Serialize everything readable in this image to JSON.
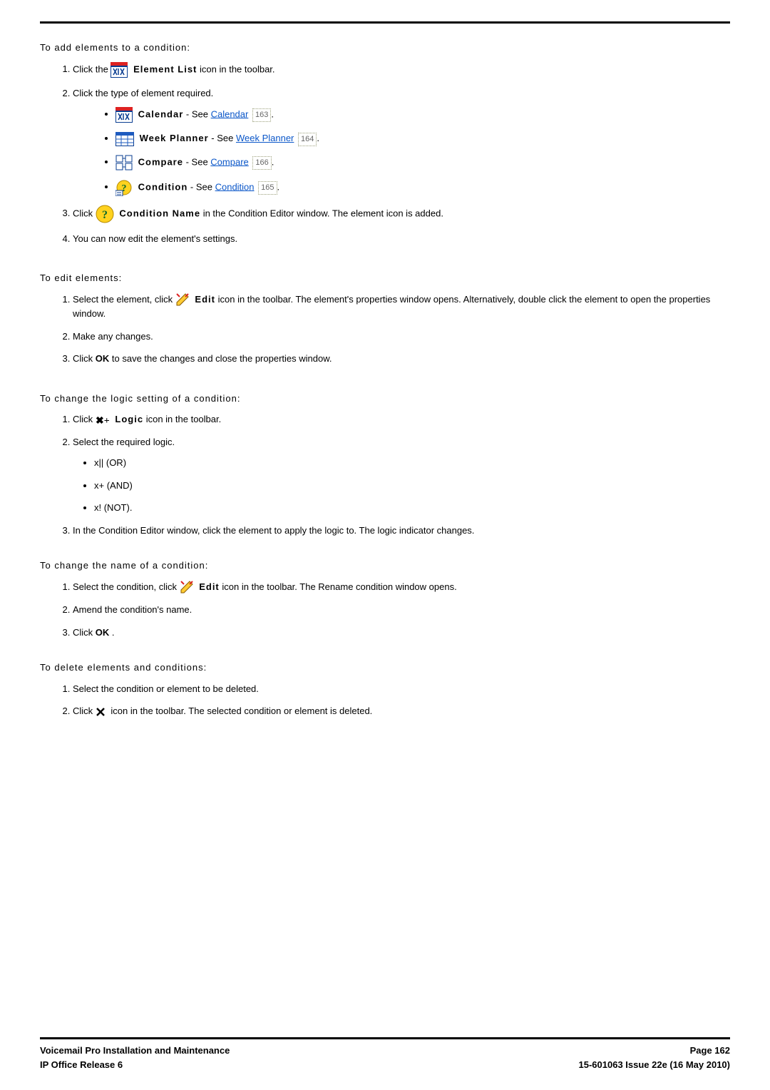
{
  "sections": {
    "add_elements": {
      "heading": "To add elements to a condition:",
      "step1_a": "Click the ",
      "step1_icon_label": "Element List",
      "step1_b": " icon in the toolbar.",
      "step2": "Click the type of element required.",
      "b_calendar_prefix": "Calendar",
      "b_calendar_see": " - See ",
      "b_calendar_link": "Calendar",
      "b_calendar_ref": "163",
      "b_week_prefix": "Week Planner",
      "b_week_see": " - See ",
      "b_week_link": "Week Planner",
      "b_week_ref": "164",
      "b_compare_prefix": "Compare",
      "b_compare_see": " - See ",
      "b_compare_link": "Compare",
      "b_compare_ref": "166",
      "b_cond_prefix": "Condition",
      "b_cond_see": " - See ",
      "b_cond_link": "Condition",
      "b_cond_ref": "165",
      "step3_a": "Click ",
      "step3_label": " Condition Name",
      "step3_b": " in the Condition Editor window. The element icon is added.",
      "step4": "You can now edit the element's settings."
    },
    "edit_elements": {
      "heading": "To edit elements:",
      "step1_a": "Select the element, click ",
      "step1_label": " Edit",
      "step1_b": " icon in the toolbar. The element's properties window opens. Alternatively, double click the element to open the properties window.",
      "step2": "Make any changes.",
      "step3_a": "Click ",
      "step3_ok": "OK",
      "step3_b": " to save the changes and close the properties window."
    },
    "change_logic": {
      "heading": "To change the logic setting of a condition:",
      "step1_a": "Click ",
      "step1_label": "Logic",
      "step1_b": " icon in the toolbar.",
      "step2": "Select the required logic.",
      "opt_or": "x|| (OR)",
      "opt_and": "x+ (AND)",
      "opt_not": "x! (NOT).",
      "step3": "In the Condition Editor window, click the element to apply the logic to. The logic indicator changes."
    },
    "change_name": {
      "heading": "To change the name of a condition:",
      "step1_a": "Select the condition, click ",
      "step1_label": " Edit",
      "step1_b": " icon in the toolbar. The Rename condition window opens.",
      "step2": "Amend the condition's name.",
      "step3_a": "Click ",
      "step3_ok": "OK",
      "step3_dot": "."
    },
    "delete": {
      "heading": " To delete elements and conditions:",
      "step1": "Select the condition or element to be deleted.",
      "step2_a": "Click ",
      "step2_b": " icon in the toolbar. The selected condition or element is deleted."
    }
  },
  "footer": {
    "left1": "Voicemail Pro Installation and Maintenance",
    "left2": "IP Office Release 6",
    "right1": "Page 162",
    "right2": "15-601063 Issue 22e (16 May 2010)"
  }
}
